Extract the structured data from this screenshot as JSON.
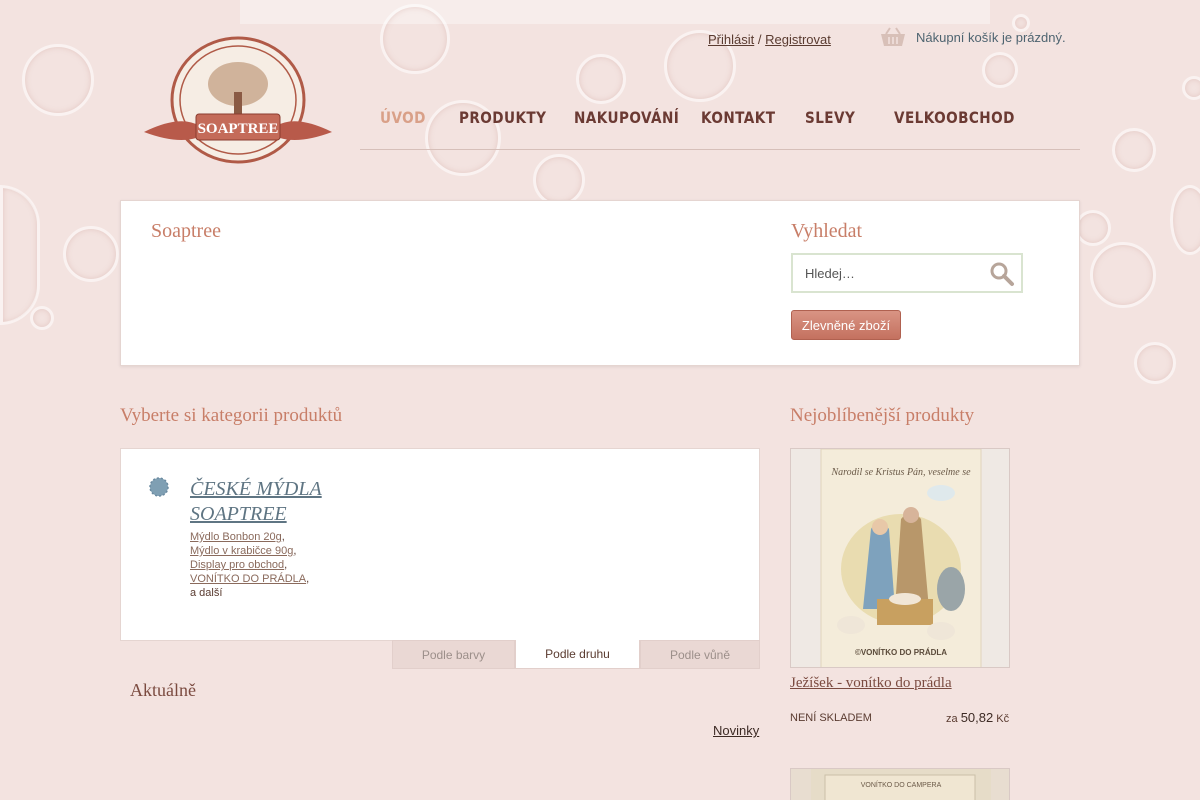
{
  "header": {
    "logo_text": "SOAPTREE",
    "auth": {
      "login": "Přihlásit",
      "separator": "/",
      "register": "Registrovat"
    },
    "cart": {
      "status": "Nákupní košík je prázdný.",
      "icon": "basket-icon"
    }
  },
  "nav": {
    "items": [
      {
        "label": "Úvod",
        "active": true
      },
      {
        "label": "Produkty",
        "active": false
      },
      {
        "label": "Nakupování",
        "active": false
      },
      {
        "label": "Kontakt",
        "active": false
      },
      {
        "label": "Slevy",
        "active": false
      },
      {
        "label": "Velkoobchod",
        "active": false
      }
    ]
  },
  "intro": {
    "site_title": "Soaptree",
    "search_heading": "Vyhledat",
    "search_placeholder": "Hledej…",
    "discount_button": "Zlevněné zboží"
  },
  "categories": {
    "heading": "Vyberte si kategorii produktů",
    "category_title": "ČESKÉ MÝDLA SOAPTREE",
    "links": [
      "Mýdlo Bonbon 20g",
      "Mýdlo v krabičce 90g",
      "Display pro obchod",
      "VONÍTKO DO PRÁDLA"
    ],
    "more": "a další",
    "tabs": [
      {
        "label": "Podle barvy",
        "active": false
      },
      {
        "label": "Podle druhu",
        "active": true
      },
      {
        "label": "Podle vůně",
        "active": false
      }
    ]
  },
  "news": {
    "heading": "Aktuálně",
    "link": "Novinky"
  },
  "popular": {
    "heading": "Nejoblíbenější produkty",
    "products": [
      {
        "name": "Ježíšek - vonítko do prádla",
        "stock": "NENÍ SKLADEM",
        "price_prefix": "za",
        "price": "50,82",
        "currency": "Kč",
        "image_caption_top": "Narodil se Kristus Pán, veselme se",
        "image_caption_bottom": "©VONÍTKO DO PRÁDLA"
      },
      {
        "image_caption_top": "VONÍTKO DO CAMPERA"
      }
    ]
  },
  "colors": {
    "accent": "#c87e68",
    "nav_active": "#d9a088",
    "link_blue": "#5f7583",
    "background": "#f3e3e0"
  }
}
